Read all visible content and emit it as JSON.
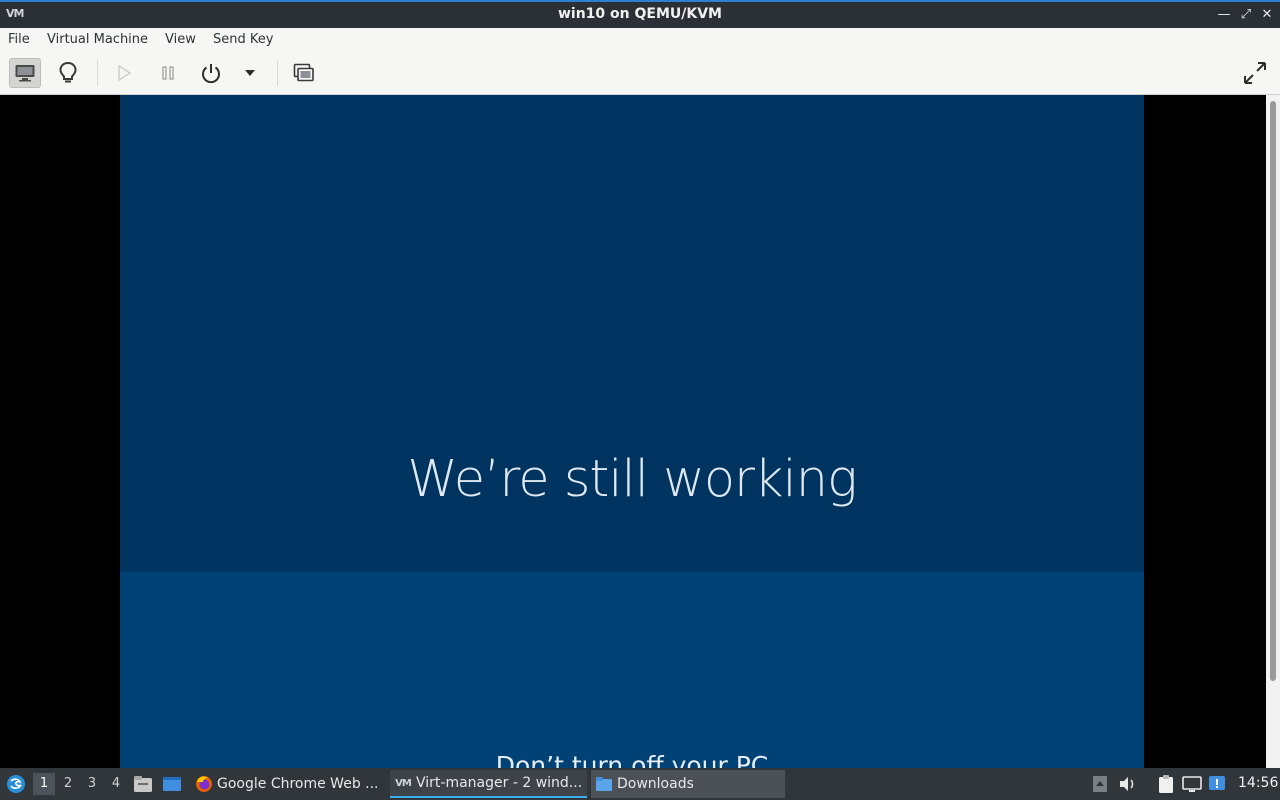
{
  "window": {
    "title": "win10 on QEMU/KVM",
    "app_icon": "virt-manager-icon",
    "minimize": "—",
    "restore": "⤢",
    "close": "✕"
  },
  "menu": {
    "items": [
      "File",
      "Virtual Machine",
      "View",
      "Send Key"
    ]
  },
  "toolbar": {
    "buttons": [
      "console-icon",
      "lightbulb-icon",
      "run-icon",
      "pause-icon",
      "power-icon",
      "dropdown-arrow-icon",
      "snapshot-icon",
      "fullscreen-icon"
    ]
  },
  "guest": {
    "message": "We’re still working",
    "subtitle": "Don’t turn off your PC"
  },
  "taskbar": {
    "workspaces": [
      "1",
      "2",
      "3",
      "4"
    ],
    "active_workspace": "1",
    "tasks": [
      {
        "label": "Google Chrome Web ...",
        "icon": "firefox-icon"
      },
      {
        "label": "Virt-manager - 2 wind...",
        "icon": "virt-manager-icon"
      },
      {
        "label": "Downloads",
        "icon": "folder-icon"
      }
    ],
    "clock": "14:56"
  },
  "colors": {
    "guest_top": "#003460",
    "guest_bottom": "#004275",
    "accent": "#2f7fd1"
  }
}
